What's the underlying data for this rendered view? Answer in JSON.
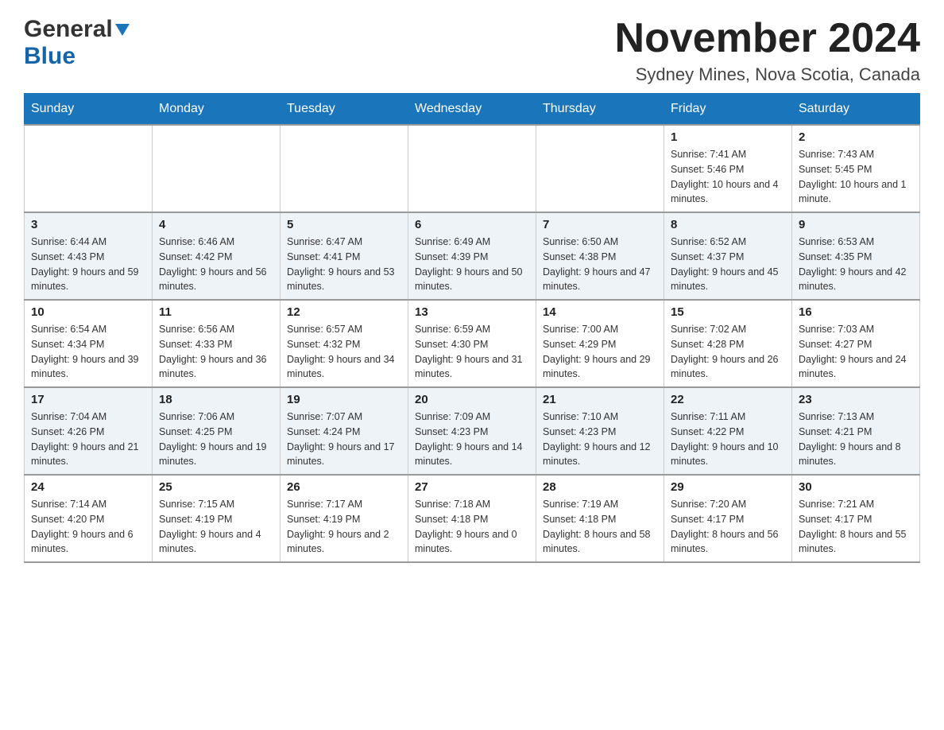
{
  "header": {
    "logo_general": "General",
    "logo_blue": "Blue",
    "main_title": "November 2024",
    "subtitle": "Sydney Mines, Nova Scotia, Canada"
  },
  "days_of_week": [
    "Sunday",
    "Monday",
    "Tuesday",
    "Wednesday",
    "Thursday",
    "Friday",
    "Saturday"
  ],
  "weeks": [
    [
      {
        "day": "",
        "info": ""
      },
      {
        "day": "",
        "info": ""
      },
      {
        "day": "",
        "info": ""
      },
      {
        "day": "",
        "info": ""
      },
      {
        "day": "",
        "info": ""
      },
      {
        "day": "1",
        "info": "Sunrise: 7:41 AM\nSunset: 5:46 PM\nDaylight: 10 hours and 4 minutes."
      },
      {
        "day": "2",
        "info": "Sunrise: 7:43 AM\nSunset: 5:45 PM\nDaylight: 10 hours and 1 minute."
      }
    ],
    [
      {
        "day": "3",
        "info": "Sunrise: 6:44 AM\nSunset: 4:43 PM\nDaylight: 9 hours and 59 minutes."
      },
      {
        "day": "4",
        "info": "Sunrise: 6:46 AM\nSunset: 4:42 PM\nDaylight: 9 hours and 56 minutes."
      },
      {
        "day": "5",
        "info": "Sunrise: 6:47 AM\nSunset: 4:41 PM\nDaylight: 9 hours and 53 minutes."
      },
      {
        "day": "6",
        "info": "Sunrise: 6:49 AM\nSunset: 4:39 PM\nDaylight: 9 hours and 50 minutes."
      },
      {
        "day": "7",
        "info": "Sunrise: 6:50 AM\nSunset: 4:38 PM\nDaylight: 9 hours and 47 minutes."
      },
      {
        "day": "8",
        "info": "Sunrise: 6:52 AM\nSunset: 4:37 PM\nDaylight: 9 hours and 45 minutes."
      },
      {
        "day": "9",
        "info": "Sunrise: 6:53 AM\nSunset: 4:35 PM\nDaylight: 9 hours and 42 minutes."
      }
    ],
    [
      {
        "day": "10",
        "info": "Sunrise: 6:54 AM\nSunset: 4:34 PM\nDaylight: 9 hours and 39 minutes."
      },
      {
        "day": "11",
        "info": "Sunrise: 6:56 AM\nSunset: 4:33 PM\nDaylight: 9 hours and 36 minutes."
      },
      {
        "day": "12",
        "info": "Sunrise: 6:57 AM\nSunset: 4:32 PM\nDaylight: 9 hours and 34 minutes."
      },
      {
        "day": "13",
        "info": "Sunrise: 6:59 AM\nSunset: 4:30 PM\nDaylight: 9 hours and 31 minutes."
      },
      {
        "day": "14",
        "info": "Sunrise: 7:00 AM\nSunset: 4:29 PM\nDaylight: 9 hours and 29 minutes."
      },
      {
        "day": "15",
        "info": "Sunrise: 7:02 AM\nSunset: 4:28 PM\nDaylight: 9 hours and 26 minutes."
      },
      {
        "day": "16",
        "info": "Sunrise: 7:03 AM\nSunset: 4:27 PM\nDaylight: 9 hours and 24 minutes."
      }
    ],
    [
      {
        "day": "17",
        "info": "Sunrise: 7:04 AM\nSunset: 4:26 PM\nDaylight: 9 hours and 21 minutes."
      },
      {
        "day": "18",
        "info": "Sunrise: 7:06 AM\nSunset: 4:25 PM\nDaylight: 9 hours and 19 minutes."
      },
      {
        "day": "19",
        "info": "Sunrise: 7:07 AM\nSunset: 4:24 PM\nDaylight: 9 hours and 17 minutes."
      },
      {
        "day": "20",
        "info": "Sunrise: 7:09 AM\nSunset: 4:23 PM\nDaylight: 9 hours and 14 minutes."
      },
      {
        "day": "21",
        "info": "Sunrise: 7:10 AM\nSunset: 4:23 PM\nDaylight: 9 hours and 12 minutes."
      },
      {
        "day": "22",
        "info": "Sunrise: 7:11 AM\nSunset: 4:22 PM\nDaylight: 9 hours and 10 minutes."
      },
      {
        "day": "23",
        "info": "Sunrise: 7:13 AM\nSunset: 4:21 PM\nDaylight: 9 hours and 8 minutes."
      }
    ],
    [
      {
        "day": "24",
        "info": "Sunrise: 7:14 AM\nSunset: 4:20 PM\nDaylight: 9 hours and 6 minutes."
      },
      {
        "day": "25",
        "info": "Sunrise: 7:15 AM\nSunset: 4:19 PM\nDaylight: 9 hours and 4 minutes."
      },
      {
        "day": "26",
        "info": "Sunrise: 7:17 AM\nSunset: 4:19 PM\nDaylight: 9 hours and 2 minutes."
      },
      {
        "day": "27",
        "info": "Sunrise: 7:18 AM\nSunset: 4:18 PM\nDaylight: 9 hours and 0 minutes."
      },
      {
        "day": "28",
        "info": "Sunrise: 7:19 AM\nSunset: 4:18 PM\nDaylight: 8 hours and 58 minutes."
      },
      {
        "day": "29",
        "info": "Sunrise: 7:20 AM\nSunset: 4:17 PM\nDaylight: 8 hours and 56 minutes."
      },
      {
        "day": "30",
        "info": "Sunrise: 7:21 AM\nSunset: 4:17 PM\nDaylight: 8 hours and 55 minutes."
      }
    ]
  ]
}
